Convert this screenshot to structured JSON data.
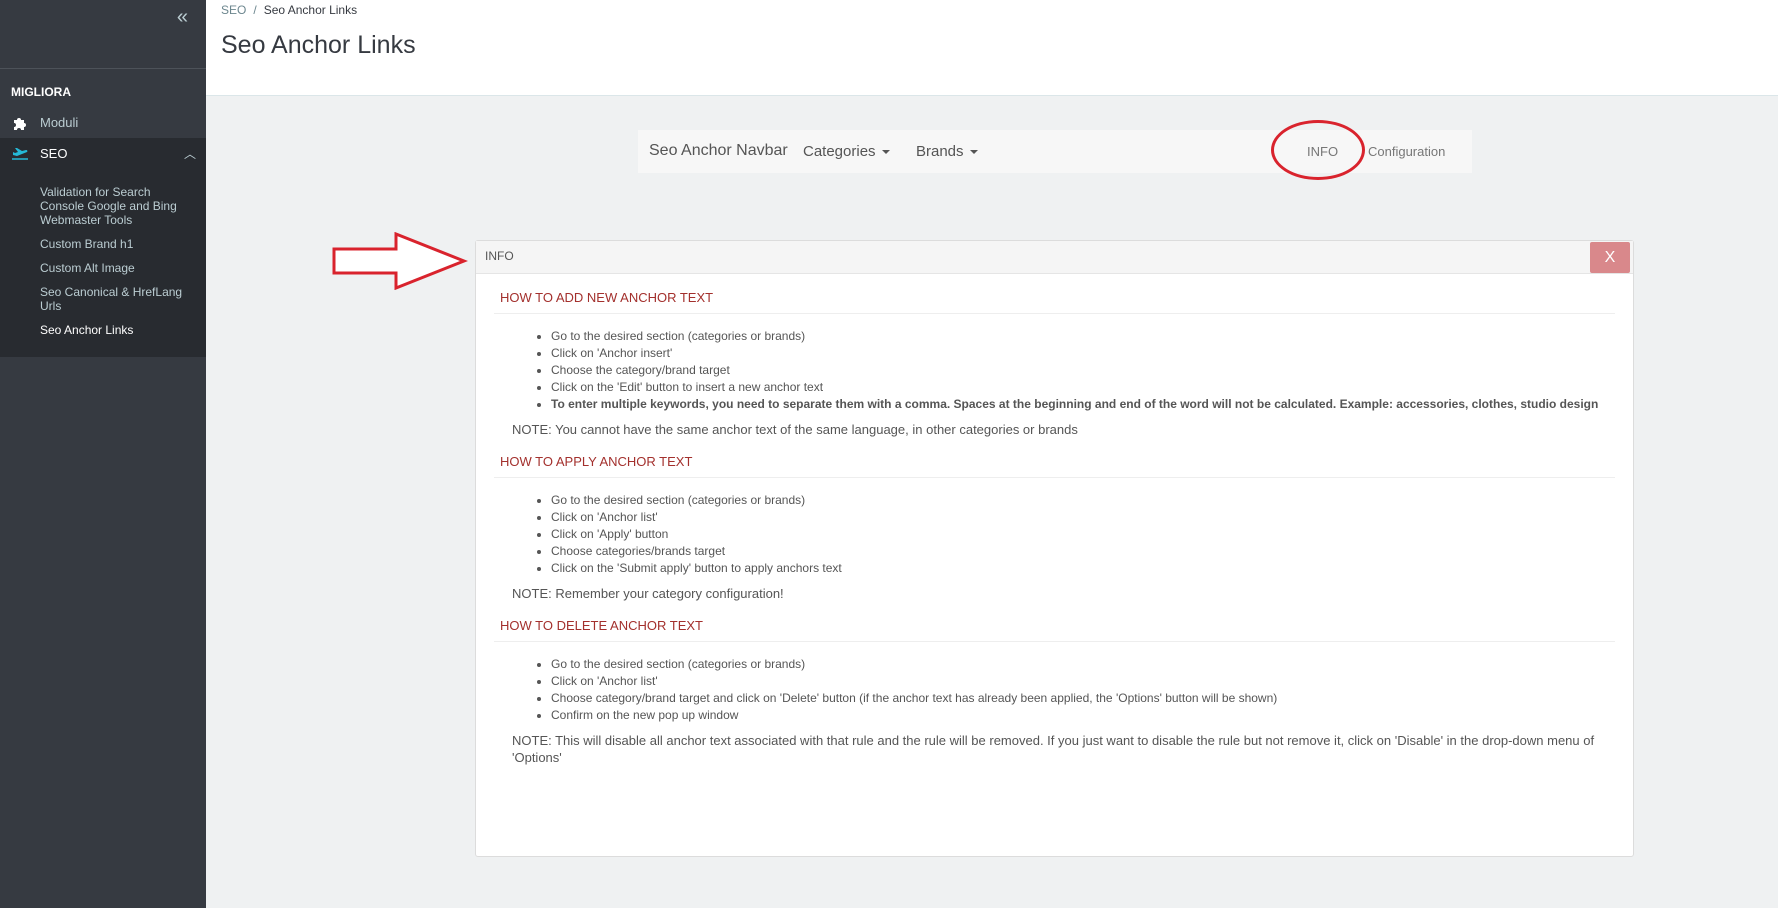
{
  "sidebar": {
    "collapse_icon": "double-chevron-left-icon",
    "section_label": "MIGLIORA",
    "items": [
      {
        "label": "Moduli",
        "icon": "puzzle-icon"
      },
      {
        "label": "SEO",
        "icon": "plane-icon"
      }
    ],
    "submenu": [
      "Validation for Search Console Google and Bing Webmaster Tools",
      "Custom Brand h1",
      "Custom Alt Image",
      "Seo Canonical & HrefLang Urls",
      "Seo Anchor Links"
    ]
  },
  "header": {
    "breadcrumb": [
      "SEO",
      "Seo Anchor Links"
    ],
    "breadcrumb_sep": "/",
    "title": "Seo Anchor Links"
  },
  "navbar": {
    "brand": "Seo Anchor Navbar",
    "categories": "Categories",
    "brands": "Brands",
    "info": "INFO",
    "configuration": "Configuration"
  },
  "panel": {
    "title": "INFO",
    "close_label": "X",
    "sections": [
      {
        "title": "HOW TO ADD NEW ANCHOR TEXT",
        "steps": [
          "Go to the desired section (categories or brands)",
          "Click on 'Anchor insert'",
          "Choose the category/brand target",
          "Click on the 'Edit' button to insert a new anchor text",
          "To enter multiple keywords, you need to separate them with a comma. Spaces at the beginning and end of the word will not be calculated. Example: accessories, clothes, studio design"
        ],
        "note": "NOTE: You cannot have the same anchor text of the same language, in other categories or brands"
      },
      {
        "title": "HOW TO APPLY ANCHOR TEXT",
        "steps": [
          "Go to the desired section (categories or brands)",
          "Click on 'Anchor list'",
          "Click on 'Apply' button",
          "Choose categories/brands target",
          "Click on the 'Submit apply' button to apply anchors text"
        ],
        "note": "NOTE: Remember your category configuration!"
      },
      {
        "title": "HOW TO DELETE ANCHOR TEXT",
        "steps": [
          "Go to the desired section (categories or brands)",
          "Click on 'Anchor list'",
          "Choose category/brand target and click on 'Delete' button (if the anchor text has already been applied, the 'Options' button will be shown)",
          "Confirm on the new pop up window"
        ],
        "note": "NOTE: This will disable all anchor text associated with that rule and the rule will be removed. If you just want to disable the rule but not remove it, click on 'Disable' in the drop-down menu of 'Options'"
      }
    ]
  },
  "colors": {
    "annotation": "#d9232d",
    "section_title": "#a3302d",
    "sidebar_bg": "#363a41"
  }
}
